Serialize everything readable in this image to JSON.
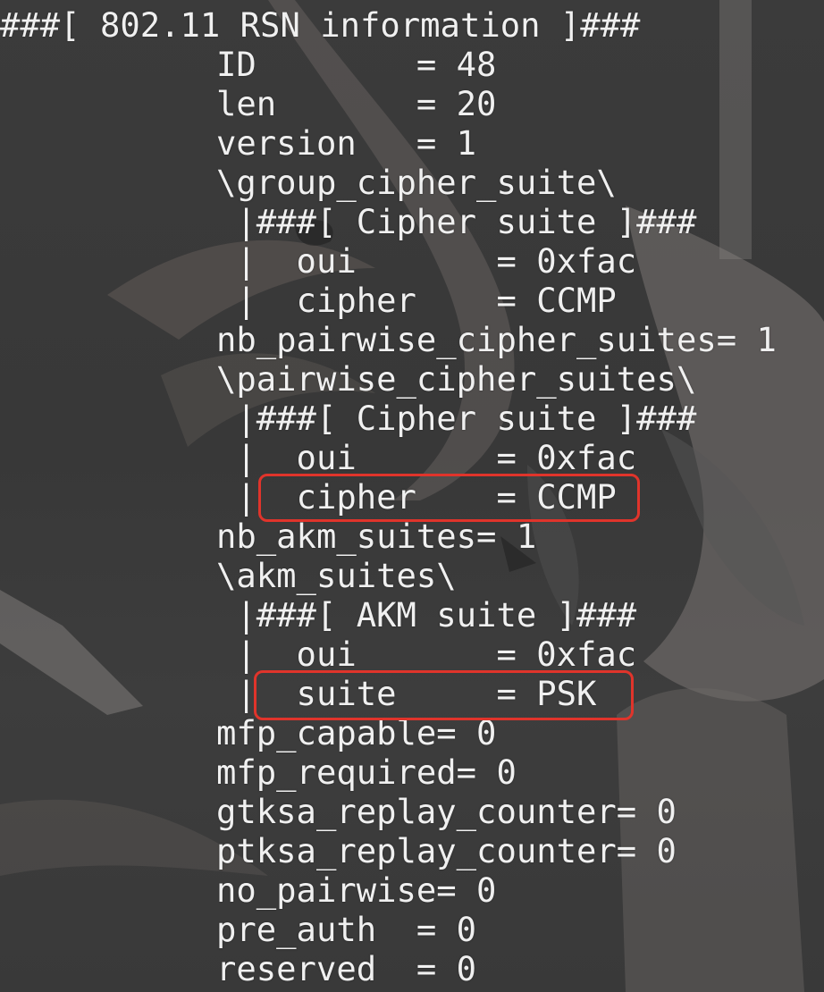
{
  "terminal": {
    "lines": [
      "###[ 802.11 RSN information ]###",
      "ID        = 48",
      "len       = 20",
      "version   = 1",
      "\\group_cipher_suite\\",
      " |###[ Cipher suite ]###",
      " |  oui       = 0xfac",
      " |  cipher    = CCMP",
      "nb_pairwise_cipher_suites= 1",
      "\\pairwise_cipher_suites\\",
      " |###[ Cipher suite ]###",
      " |  oui       = 0xfac",
      " |  cipher    = CCMP",
      "nb_akm_suites= 1",
      "\\akm_suites\\",
      " |###[ AKM suite ]###",
      " |  oui       = 0xfac",
      " |  suite     = PSK",
      "mfp_capable= 0",
      "mfp_required= 0",
      "gtksa_replay_counter= 0",
      "ptksa_replay_counter= 0",
      "no_pairwise= 0",
      "pre_auth  = 0",
      "reserved  = 0"
    ]
  },
  "colors": {
    "text": "#f0f0f0",
    "background": "#3a3a3a",
    "highlight_border": "#e0342b"
  }
}
